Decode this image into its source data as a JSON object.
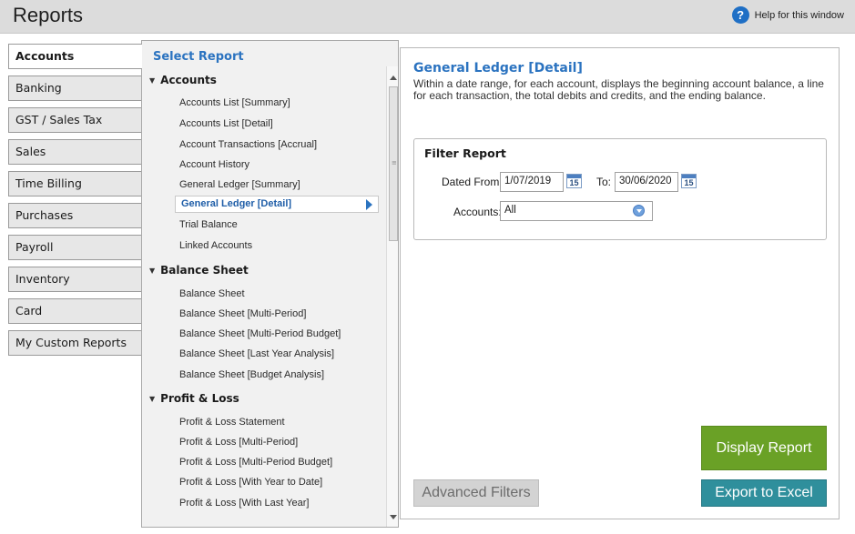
{
  "window": {
    "title": "Reports",
    "help_label": "Help for this window",
    "help_icon": "?"
  },
  "tabs": [
    {
      "label": "Accounts",
      "active": true
    },
    {
      "label": "Banking"
    },
    {
      "label": "GST / Sales Tax"
    },
    {
      "label": "Sales"
    },
    {
      "label": "Time Billing"
    },
    {
      "label": "Purchases"
    },
    {
      "label": "Payroll"
    },
    {
      "label": "Inventory"
    },
    {
      "label": "Card"
    },
    {
      "label": "My Custom Reports"
    }
  ],
  "report_list": {
    "heading": "Select Report",
    "groups": [
      {
        "label": "Accounts",
        "items": [
          "Accounts List [Summary]",
          "Accounts List [Detail]",
          "Account Transactions [Accrual]",
          "Account History",
          "General Ledger [Summary]",
          "General Ledger [Detail]",
          "Trial Balance",
          "Linked Accounts"
        ]
      },
      {
        "label": "Balance Sheet",
        "items": [
          "Balance Sheet",
          "Balance Sheet [Multi-Period]",
          "Balance Sheet [Multi-Period Budget]",
          "Balance Sheet [Last Year Analysis]",
          "Balance Sheet [Budget Analysis]"
        ]
      },
      {
        "label": "Profit & Loss",
        "items": [
          "Profit & Loss Statement",
          "Profit & Loss [Multi-Period]",
          "Profit & Loss [Multi-Period Budget]",
          "Profit & Loss [With Year to Date]",
          "Profit & Loss [With Last Year]"
        ]
      }
    ],
    "selected": "General Ledger [Detail]"
  },
  "detail": {
    "title": "General Ledger [Detail]",
    "description": "Within a date range, for each account, displays the beginning account balance, a line for each transaction, the total debits and credits, and the ending balance.",
    "filter": {
      "heading": "Filter Report",
      "dated_from_label": "Dated From:",
      "dated_from_value": "1/07/2019",
      "to_label": "To:",
      "to_value": "30/06/2020",
      "calendar_day": "15",
      "accounts_label": "Accounts:",
      "accounts_value": "All"
    },
    "buttons": {
      "display": "Display Report",
      "export": "Export to Excel",
      "advanced": "Advanced Filters"
    }
  }
}
